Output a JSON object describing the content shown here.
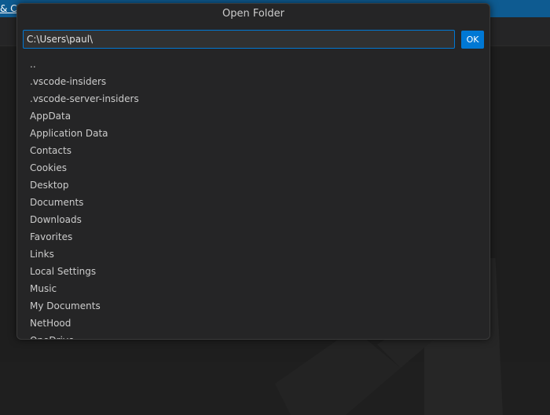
{
  "background": {
    "link_text": "& Co",
    "accent_color": "#0e5b91"
  },
  "dialog": {
    "title": "Open Folder",
    "input_value": "C:\\Users\\paul\\",
    "ok_label": "OK",
    "ok_color": "#0078d4",
    "items": [
      "..",
      ".vscode-insiders",
      ".vscode-server-insiders",
      "AppData",
      "Application Data",
      "Contacts",
      "Cookies",
      "Desktop",
      "Documents",
      "Downloads",
      "Favorites",
      "Links",
      "Local Settings",
      "Music",
      "My Documents",
      "NetHood",
      "OneDrive"
    ]
  }
}
